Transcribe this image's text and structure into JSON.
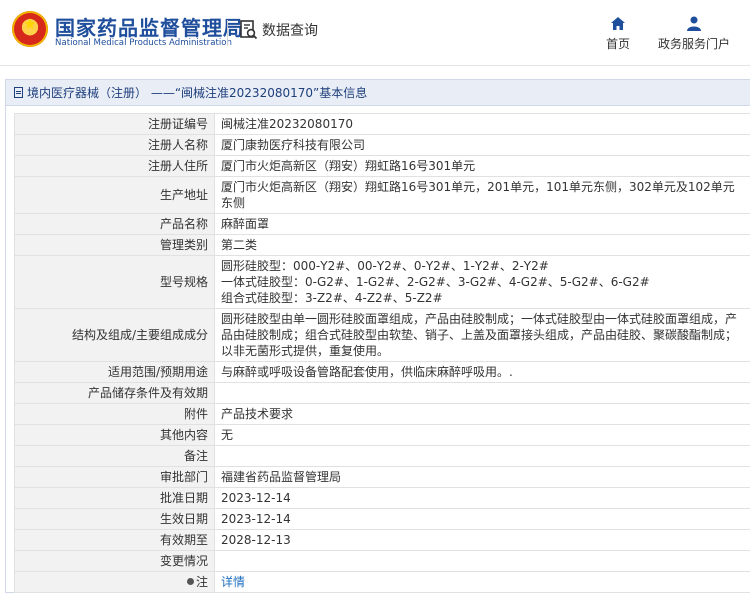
{
  "header": {
    "brand_cn": "国家药品监督管理局",
    "brand_en": "National Medical Products Administration",
    "query_label": "数据查询",
    "nav": [
      {
        "label": "首页",
        "icon": "home-icon"
      },
      {
        "label": "政务服务门户",
        "icon": "person-icon"
      }
    ]
  },
  "panel": {
    "title": "境内医疗器械（注册） ——“闽械注准20232080170”基本信息"
  },
  "rows": [
    {
      "label": "注册证编号",
      "value": "闽械注准20232080170"
    },
    {
      "label": "注册人名称",
      "value": "厦门康勃医疗科技有限公司"
    },
    {
      "label": "注册人住所",
      "value": "厦门市火炬高新区（翔安）翔虹路16号301单元"
    },
    {
      "label": "生产地址",
      "value": "厦门市火炬高新区（翔安）翔虹路16号301单元，201单元，101单元东侧，302单元及102单元东侧"
    },
    {
      "label": "产品名称",
      "value": "麻醉面罩"
    },
    {
      "label": "管理类别",
      "value": "第二类"
    },
    {
      "label": "型号规格",
      "value_lines": [
        "圆形硅胶型：000-Y2#、00-Y2#、0-Y2#、1-Y2#、2-Y2#",
        "一体式硅胶型：0-G2#、1-G2#、2-G2#、3-G2#、4-G2#、5-G2#、6-G2#",
        "组合式硅胶型：3-Z2#、4-Z2#、5-Z2#"
      ]
    },
    {
      "label": "结构及组成/主要组成成分",
      "value": "圆形硅胶型由单一圆形硅胶面罩组成，产品由硅胶制成；一体式硅胶型由一体式硅胶面罩组成，产品由硅胶制成；组合式硅胶型由软垫、销子、上盖及面罩接头组成，产品由硅胶、聚碳酸酯制成；以非无菌形式提供，重复使用。"
    },
    {
      "label": "适用范围/预期用途",
      "value": "与麻醉或呼吸设备管路配套使用，供临床麻醉呼吸用。."
    },
    {
      "label": "产品储存条件及有效期",
      "value": ""
    },
    {
      "label": "附件",
      "value": "产品技术要求"
    },
    {
      "label": "其他内容",
      "value": "无"
    },
    {
      "label": "备注",
      "value": ""
    },
    {
      "label": "审批部门",
      "value": "福建省药品监督管理局"
    },
    {
      "label": "批准日期",
      "value": "2023-12-14"
    },
    {
      "label": "生效日期",
      "value": "2023-12-14"
    },
    {
      "label": "有效期至",
      "value": "2028-12-13"
    },
    {
      "label": "变更情况",
      "value": ""
    },
    {
      "label": "注",
      "value": "详情",
      "icon": "bulb-icon"
    }
  ]
}
